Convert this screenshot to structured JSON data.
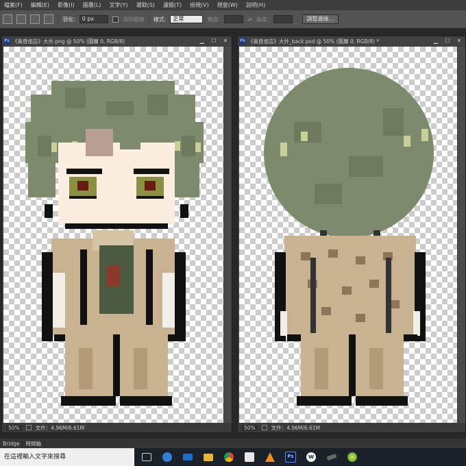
{
  "menubar": {
    "items": [
      "檔案(F)",
      "編輯(E)",
      "影像(I)",
      "圖層(L)",
      "文字(Y)",
      "選取(S)",
      "濾鏡(T)",
      "檢視(V)",
      "視窗(W)",
      "說明(H)"
    ]
  },
  "options": {
    "feather_label": "羽化:",
    "feather_value": "0 px",
    "antialias_label": "消除鋸齒",
    "style_label": "樣式:",
    "style_value": "正常",
    "width_label": "寬度:",
    "height_label": "高度:",
    "refine_edge_button": "調整邊緣..."
  },
  "documents": [
    {
      "title": "《黃昏旅店》大外.png @ 50% (圖層 0, RGB/8)",
      "zoom": "50%",
      "file_info": "文件：4.96M/6.61M"
    },
    {
      "title": "《黃昏旅店》大外_back.psd @ 50% (圖層 0, RGB/8) *",
      "zoom": "50%",
      "file_info": "文件：4.96M/6.61M"
    }
  ],
  "panel_tabs": [
    "Bridge",
    "時間軸"
  ],
  "taskbar": {
    "search_placeholder": "在這裡輸入文字來搜尋",
    "icons": [
      "task-view-icon",
      "edge-icon",
      "mail-icon",
      "file-explorer-icon",
      "chrome-icon",
      "store-icon",
      "vlc-icon",
      "photoshop-icon",
      "app-w-icon",
      "app-dark-icon",
      "app-green-icon"
    ]
  },
  "window_buttons": {
    "minimize": "▁",
    "maximize": "☐",
    "close": "✕"
  },
  "colors": {
    "hair": "#7e8a6c",
    "hair_highlight": "#c9cf96",
    "skin": "#fbeee0",
    "coat": "#c8b291",
    "outline": "#111111"
  }
}
